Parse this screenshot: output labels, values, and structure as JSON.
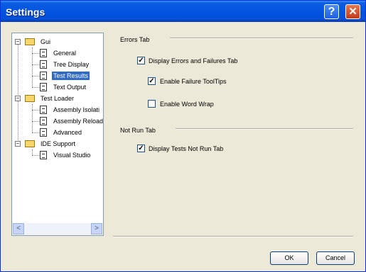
{
  "window": {
    "title": "Settings",
    "help_glyph": "?",
    "close_glyph": "✕"
  },
  "tree": {
    "nodes": [
      {
        "label": "Gui"
      },
      {
        "label": "General"
      },
      {
        "label": "Tree Display"
      },
      {
        "label": "Test Results"
      },
      {
        "label": "Text Output"
      },
      {
        "label": "Test Loader"
      },
      {
        "label": "Assembly Isolati"
      },
      {
        "label": "Assembly Reload"
      },
      {
        "label": "Advanced"
      },
      {
        "label": "IDE Support"
      },
      {
        "label": "Visual Studio"
      }
    ],
    "selected": "Test Results",
    "scroll_left": "<",
    "scroll_right": ">"
  },
  "errors_tab": {
    "title": "Errors Tab",
    "display_errors": {
      "label": "Display Errors and Failures Tab",
      "checked": true
    },
    "failure_tooltips": {
      "label": "Enable Failure ToolTips",
      "checked": true
    },
    "word_wrap": {
      "label": "Enable Word Wrap",
      "checked": false
    }
  },
  "not_run_tab": {
    "title": "Not Run Tab",
    "display_not_run": {
      "label": "Display Tests Not Run Tab",
      "checked": true
    }
  },
  "buttons": {
    "ok": "OK",
    "cancel": "Cancel"
  }
}
